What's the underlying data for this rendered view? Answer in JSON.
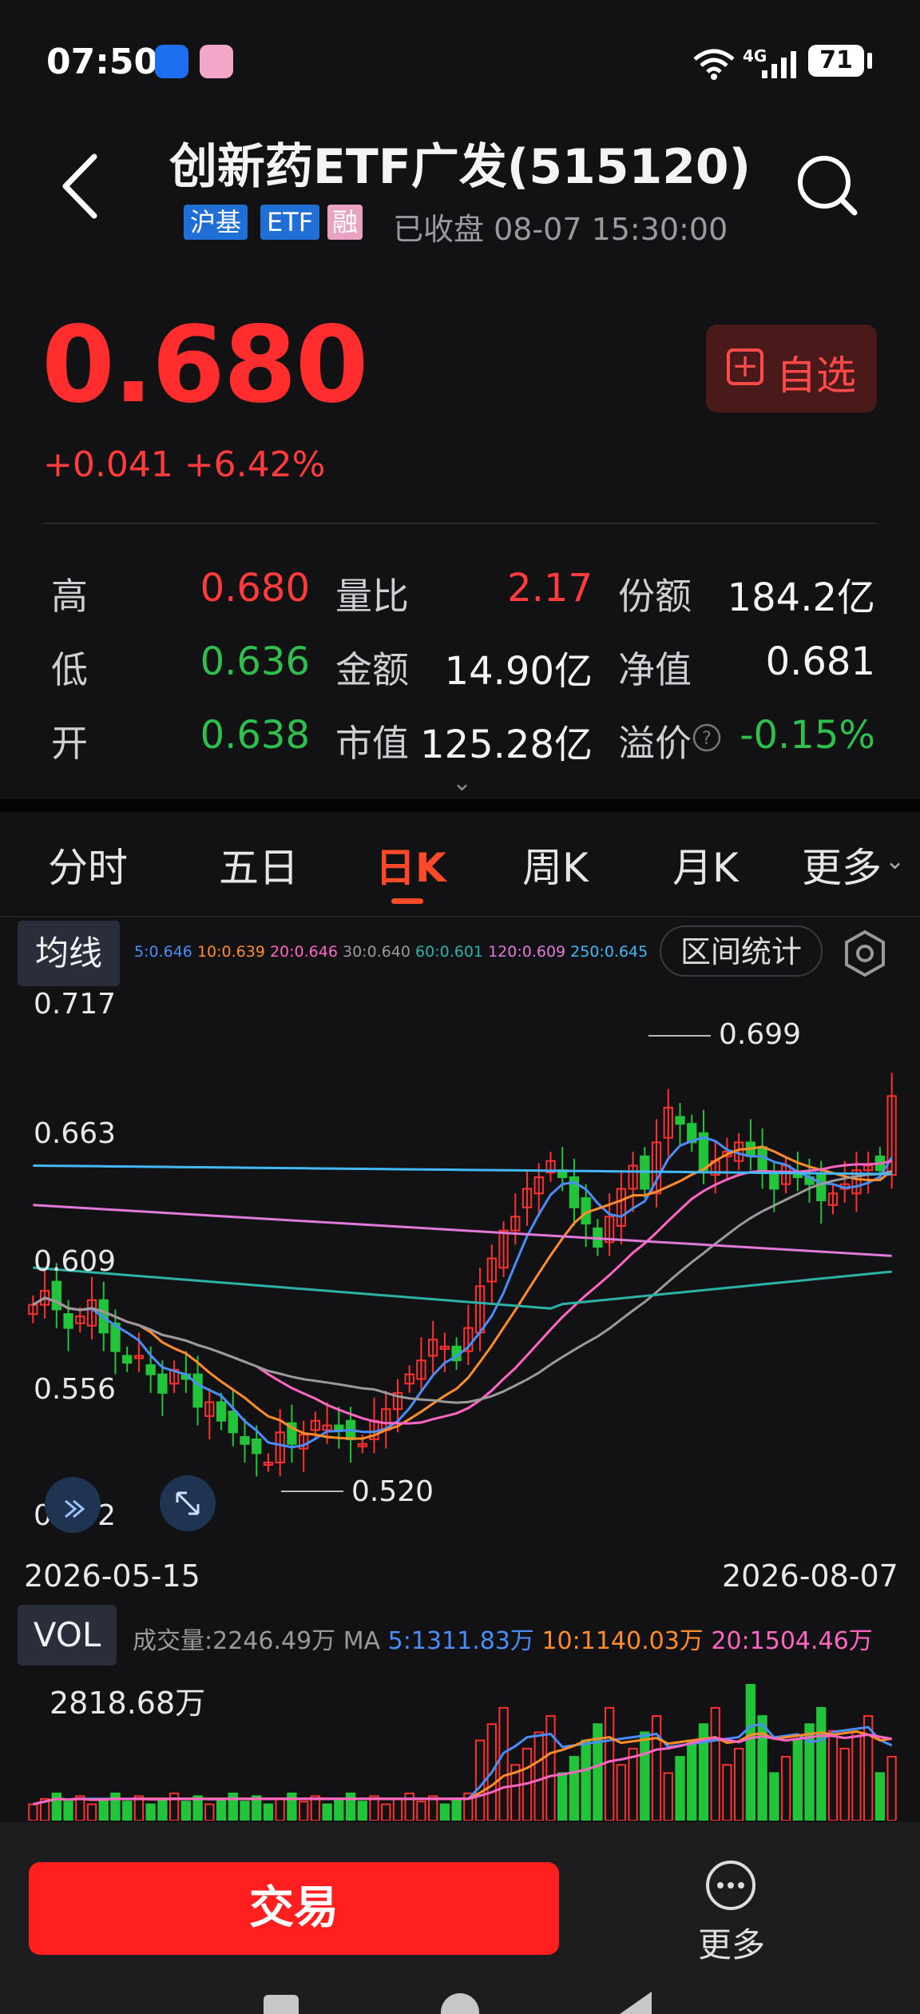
{
  "status_bar": {
    "time": "07:50",
    "network": "4G",
    "battery": "71"
  },
  "header": {
    "title": "创新药ETF广发(515120)",
    "tags": [
      "沪基",
      "ETF",
      "融"
    ],
    "trade_status": "已收盘 08-07 15:30:00"
  },
  "quote": {
    "price": "0.680",
    "change": "+0.041 +6.42%",
    "watch_label": "自选",
    "stats": [
      {
        "label": "高",
        "value": "0.680",
        "tone": "red"
      },
      {
        "label": "量比",
        "value": "2.17",
        "tone": "red"
      },
      {
        "label": "份额",
        "value": "184.2亿",
        "tone": "white"
      },
      {
        "label": "低",
        "value": "0.636",
        "tone": "green"
      },
      {
        "label": "金额",
        "value": "14.90亿",
        "tone": "white"
      },
      {
        "label": "净值",
        "value": "0.681",
        "tone": "white"
      },
      {
        "label": "开",
        "value": "0.638",
        "tone": "green"
      },
      {
        "label": "市值",
        "value": "125.28亿",
        "tone": "white"
      },
      {
        "label": "溢价",
        "value": "-0.15%",
        "tone": "green"
      }
    ]
  },
  "tabs": [
    "分时",
    "五日",
    "日K",
    "周K",
    "月K",
    "更多"
  ],
  "active_tab": "日K",
  "ma_bar": {
    "button": "均线",
    "items": [
      {
        "text": "5:0.646",
        "color": "#4a8df8"
      },
      {
        "text": "10:0.639",
        "color": "#ff8c2a"
      },
      {
        "text": "20:0.646",
        "color": "#ff66c4"
      },
      {
        "text": "30:0.640",
        "color": "#9a9a9a"
      },
      {
        "text": "60:0.601",
        "color": "#2bb3a8"
      },
      {
        "text": "120:0.609",
        "color": "#e07ad8"
      },
      {
        "text": "250:0.645",
        "color": "#42b8f5"
      }
    ],
    "range_button": "区间统计"
  },
  "chart_data": {
    "type": "candlestick",
    "y_ticks": [
      "0.717",
      "0.663",
      "0.609",
      "0.556",
      "0.502"
    ],
    "ylim": [
      0.502,
      0.717
    ],
    "x_start": "2026-05-15",
    "x_end": "2026-08-07",
    "annotations": [
      {
        "text": "0.699",
        "value": 0.699
      },
      {
        "text": "0.520",
        "value": 0.52
      }
    ],
    "closes": [
      0.59,
      0.596,
      0.588,
      0.58,
      0.585,
      0.592,
      0.578,
      0.57,
      0.565,
      0.568,
      0.56,
      0.552,
      0.562,
      0.558,
      0.546,
      0.548,
      0.54,
      0.535,
      0.53,
      0.526,
      0.522,
      0.535,
      0.53,
      0.534,
      0.54,
      0.538,
      0.536,
      0.532,
      0.53,
      0.54,
      0.545,
      0.552,
      0.56,
      0.566,
      0.575,
      0.572,
      0.566,
      0.58,
      0.598,
      0.61,
      0.622,
      0.628,
      0.64,
      0.645,
      0.652,
      0.645,
      0.632,
      0.625,
      0.615,
      0.628,
      0.64,
      0.65,
      0.64,
      0.66,
      0.675,
      0.668,
      0.66,
      0.648,
      0.652,
      0.656,
      0.66,
      0.654,
      0.648,
      0.64,
      0.65,
      0.645,
      0.642,
      0.635,
      0.638,
      0.642,
      0.648,
      0.65,
      0.648,
      0.68
    ]
  },
  "volume": {
    "button": "VOL",
    "summary": "成交量:2246.49万 MA",
    "ma5": "5:1311.83万",
    "ma10": "10:1140.03万",
    "ma20": "20:1504.46万",
    "max": "2818.68万"
  },
  "bottom": {
    "trade": "交易",
    "more": "更多"
  }
}
